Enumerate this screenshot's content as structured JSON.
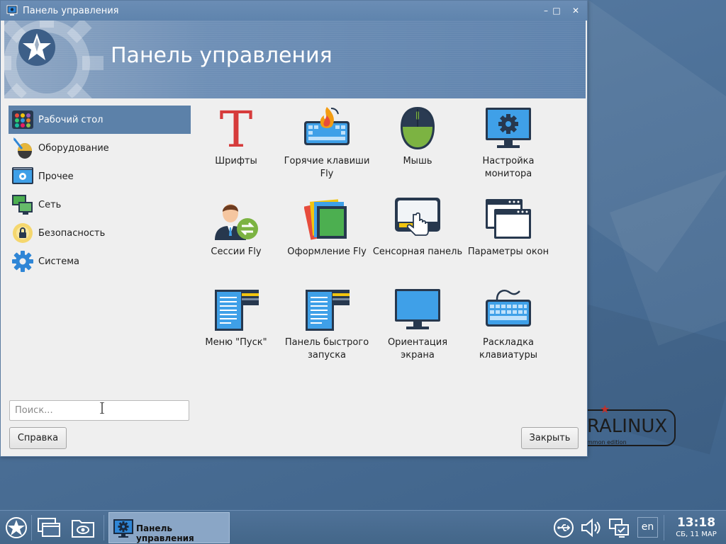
{
  "window": {
    "title": "Панель управления",
    "heading": "Панель управления",
    "controls": {
      "minimize": "–",
      "maximize": "□",
      "close": "✕"
    }
  },
  "sidebar": {
    "items": [
      {
        "label": "Рабочий стол",
        "icon": "desktop-icon",
        "active": true
      },
      {
        "label": "Оборудование",
        "icon": "hardware-icon",
        "active": false
      },
      {
        "label": "Прочее",
        "icon": "other-icon",
        "active": false
      },
      {
        "label": "Сеть",
        "icon": "network-icon",
        "active": false
      },
      {
        "label": "Безопасность",
        "icon": "security-icon",
        "active": false
      },
      {
        "label": "Система",
        "icon": "system-gear-icon",
        "active": false
      }
    ]
  },
  "search": {
    "placeholder": "Поиск...",
    "value": ""
  },
  "buttons": {
    "help": "Справка",
    "close": "Закрыть"
  },
  "grid": {
    "items": [
      {
        "label": "Шрифты",
        "icon": "fonts-icon"
      },
      {
        "label": "Горячие клавиши Fly",
        "icon": "hotkeys-icon"
      },
      {
        "label": "Мышь",
        "icon": "mouse-icon"
      },
      {
        "label": "Настройка монитора",
        "icon": "monitor-settings-icon"
      },
      {
        "label": "Сессии Fly",
        "icon": "sessions-icon"
      },
      {
        "label": "Оформление Fly",
        "icon": "themes-icon"
      },
      {
        "label": "Сенсорная панель",
        "icon": "touchpad-icon"
      },
      {
        "label": "Параметры окон",
        "icon": "window-params-icon"
      },
      {
        "label": "Меню \"Пуск\"",
        "icon": "start-menu-icon"
      },
      {
        "label": "Панель быстрого запуска",
        "icon": "quick-launch-icon"
      },
      {
        "label": "Ориентация экрана",
        "icon": "screen-orientation-icon"
      },
      {
        "label": "Раскладка клавиатуры",
        "icon": "keyboard-layout-icon"
      }
    ]
  },
  "desktop": {
    "logo_text": "RALINUX",
    "logo_sub": "mmon edition"
  },
  "taskbar": {
    "task_label": "Панель управления",
    "lang": "en",
    "time": "13:18",
    "date": "СБ, 11 МАР"
  },
  "colors": {
    "accent": "#5c81a9",
    "titlebar": "#6287b0",
    "taskbar": "#4a6d92"
  }
}
